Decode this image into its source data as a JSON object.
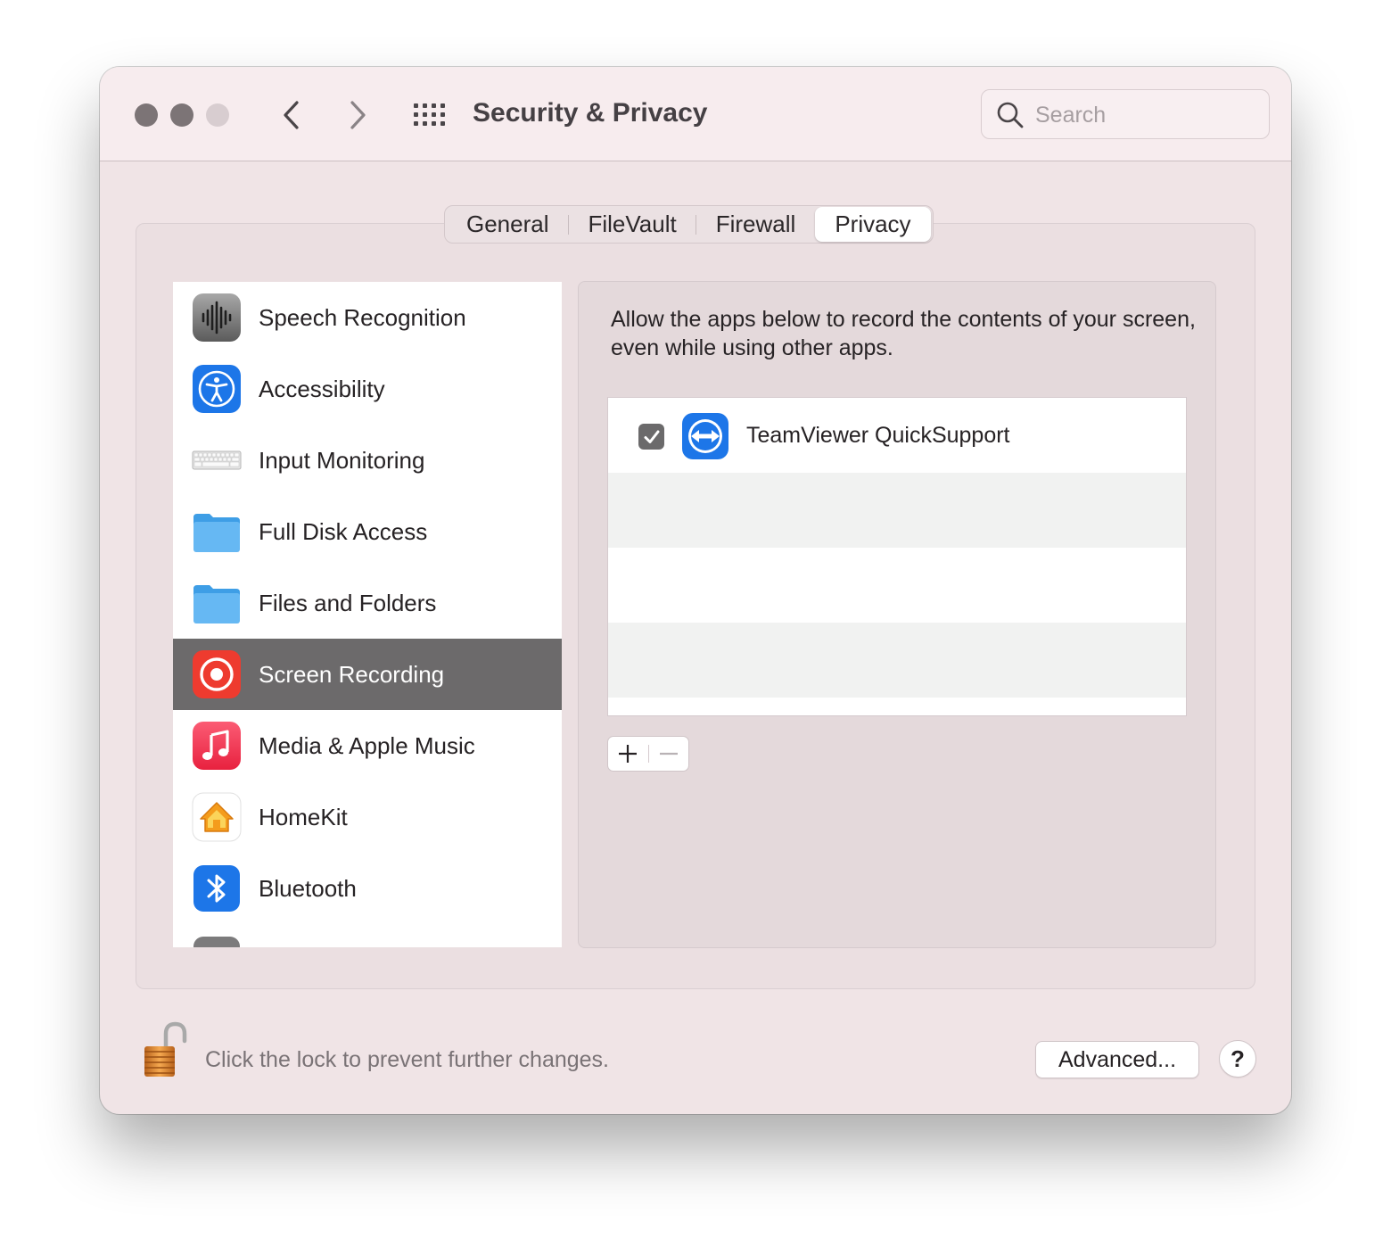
{
  "window": {
    "title": "Security & Privacy"
  },
  "toolbar": {
    "back_icon": "chevron-left-icon",
    "forward_icon": "chevron-right-icon",
    "grid_icon": "grid-icon",
    "search_placeholder": "Search"
  },
  "tabs": [
    {
      "label": "General",
      "active": false
    },
    {
      "label": "FileVault",
      "active": false
    },
    {
      "label": "Firewall",
      "active": false
    },
    {
      "label": "Privacy",
      "active": true
    }
  ],
  "sidebar": {
    "items": [
      {
        "label": "Speech Recognition",
        "icon": "speech-waveform-icon",
        "selected": false
      },
      {
        "label": "Accessibility",
        "icon": "accessibility-icon",
        "selected": false
      },
      {
        "label": "Input Monitoring",
        "icon": "keyboard-icon",
        "selected": false
      },
      {
        "label": "Full Disk Access",
        "icon": "folder-icon",
        "selected": false
      },
      {
        "label": "Files and Folders",
        "icon": "folder-icon",
        "selected": false
      },
      {
        "label": "Screen Recording",
        "icon": "screen-record-icon",
        "selected": true
      },
      {
        "label": "Media & Apple Music",
        "icon": "music-note-icon",
        "selected": false
      },
      {
        "label": "HomeKit",
        "icon": "home-icon",
        "selected": false
      },
      {
        "label": "Bluetooth",
        "icon": "bluetooth-icon",
        "selected": false
      }
    ]
  },
  "panel": {
    "description": "Allow the apps below to record the contents of your screen, even while using other apps.",
    "apps": [
      {
        "name": "TeamViewer QuickSupport",
        "checked": true,
        "icon": "teamviewer-icon"
      }
    ],
    "add_label": "+",
    "remove_label": "—"
  },
  "footer": {
    "lock_text": "Click the lock to prevent further changes.",
    "advanced_label": "Advanced...",
    "help_label": "?"
  },
  "colors": {
    "window_bg": "#f0e4e6",
    "selected_row": "#6c6a6b",
    "accent_blue": "#1d76e8",
    "record_red": "#ee3b2f"
  }
}
